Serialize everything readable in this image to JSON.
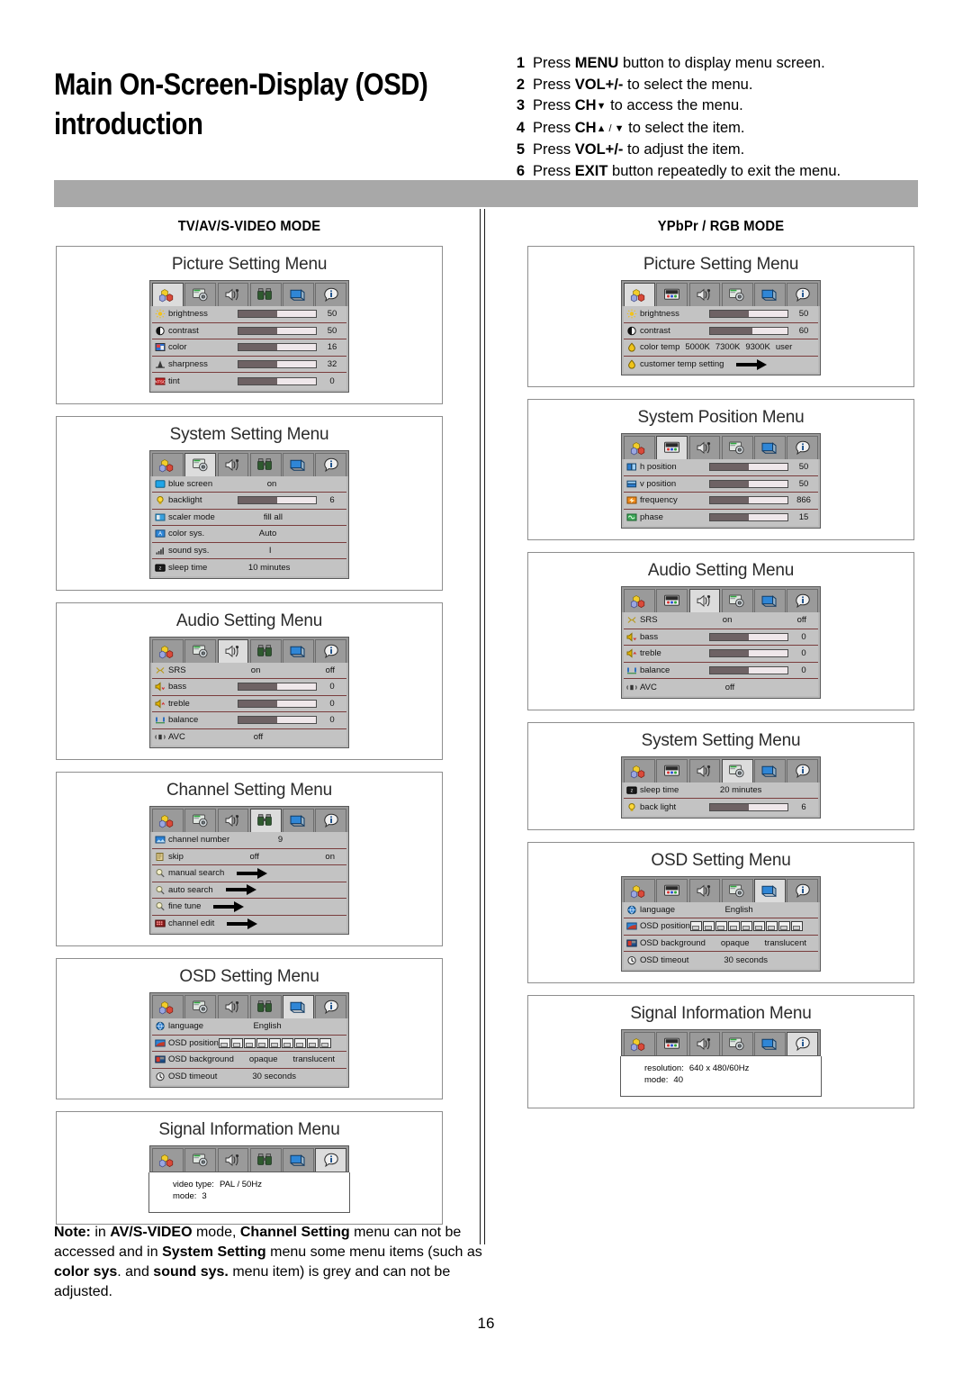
{
  "header": {
    "title": "Main On-Screen-Display (OSD) introduction",
    "steps": [
      {
        "num": "1",
        "pre": "Press ",
        "strong": "MENU",
        "post": " button to display menu screen."
      },
      {
        "num": "2",
        "pre": "Press ",
        "strong": "VOL+/-",
        "post": " to select the menu."
      },
      {
        "num": "3",
        "pre": "Press ",
        "strong": "CH",
        "glyph": "▼",
        "post": " to access the menu."
      },
      {
        "num": "4",
        "pre": "Press ",
        "strong": "CH",
        "glyph": "▲ / ▼",
        "post": " to select the item."
      },
      {
        "num": "5",
        "pre": "Press ",
        "strong": "VOL+/-",
        "post": " to adjust the item."
      },
      {
        "num": "6",
        "pre": "Press ",
        "strong": "EXIT",
        "post": " button repeatedly to exit the menu."
      }
    ]
  },
  "columns": {
    "left": {
      "heading": "TV/AV/S-VIDEO MODE",
      "menus": [
        {
          "title": "Picture Setting Menu",
          "selected_tab": 0,
          "tab_set": "tv",
          "rows": [
            {
              "icon": "brightness-icon",
              "label": "brightness",
              "type": "slider",
              "fill": 50,
              "value": "50"
            },
            {
              "icon": "contrast-icon",
              "label": "contrast",
              "type": "slider",
              "fill": 50,
              "value": "50"
            },
            {
              "icon": "color-icon",
              "label": "color",
              "type": "slider",
              "fill": 50,
              "value": "16"
            },
            {
              "icon": "sharpness-icon",
              "label": "sharpness",
              "type": "slider",
              "fill": 50,
              "value": "32"
            },
            {
              "icon": "tint-icon",
              "label": "tint",
              "type": "slider",
              "fill": 50,
              "value": "0"
            }
          ]
        },
        {
          "title": "System Setting Menu",
          "selected_tab": 1,
          "tab_set": "tv",
          "rows": [
            {
              "icon": "blue-screen-icon",
              "label": "blue screen",
              "type": "value",
              "value": "on"
            },
            {
              "icon": "backlight-icon",
              "label": "backlight",
              "type": "slider",
              "fill": 50,
              "value": "6"
            },
            {
              "icon": "scaler-icon",
              "label": "scaler mode",
              "type": "value",
              "value": "fill all"
            },
            {
              "icon": "color-sys-icon",
              "label": "color sys.",
              "type": "value",
              "value": "Auto"
            },
            {
              "icon": "sound-sys-icon",
              "label": "sound sys.",
              "type": "value",
              "value": "I"
            },
            {
              "icon": "sleep-time-icon",
              "label": "sleep time",
              "type": "value",
              "value": "10 minutes"
            }
          ]
        },
        {
          "title": "Audio Setting Menu",
          "selected_tab": 2,
          "tab_set": "tv",
          "rows": [
            {
              "icon": "srs-icon",
              "label": "SRS",
              "type": "dual",
              "value": "on",
              "value2": "off"
            },
            {
              "icon": "bass-icon",
              "label": "bass",
              "type": "slider",
              "fill": 50,
              "value": "0"
            },
            {
              "icon": "treble-icon",
              "label": "treble",
              "type": "slider",
              "fill": 50,
              "value": "0"
            },
            {
              "icon": "balance-icon",
              "label": "balance",
              "type": "slider",
              "fill": 50,
              "value": "0"
            },
            {
              "icon": "avc-icon",
              "label": "AVC",
              "type": "value",
              "value": "off"
            }
          ]
        },
        {
          "title": "Channel Setting Menu",
          "selected_tab": 3,
          "tab_set": "tv",
          "rows": [
            {
              "icon": "channel-number-icon",
              "label": "channel number",
              "type": "value",
              "value": "9"
            },
            {
              "icon": "skip-icon",
              "label": "skip",
              "type": "dual",
              "value": "off",
              "value2": "on"
            },
            {
              "icon": "search-icon",
              "label": "manual search",
              "type": "arrow"
            },
            {
              "icon": "search-icon",
              "label": "auto search",
              "type": "arrow"
            },
            {
              "icon": "search-icon",
              "label": "fine tune",
              "type": "arrow"
            },
            {
              "icon": "channel-edit-icon",
              "label": "channel edit",
              "type": "arrow"
            }
          ]
        },
        {
          "title": "OSD Setting Menu",
          "selected_tab": 4,
          "tab_set": "tv",
          "rows": [
            {
              "icon": "language-icon",
              "label": "language",
              "type": "value",
              "value": "English"
            },
            {
              "icon": "osd-position-icon",
              "label": "OSD position",
              "type": "posboxes",
              "boxes": 9
            },
            {
              "icon": "osd-background-icon",
              "label": "OSD background",
              "type": "dual",
              "value": "opaque",
              "value2": "translucent"
            },
            {
              "icon": "osd-timeout-icon",
              "label": "OSD timeout",
              "type": "value",
              "value": "30 seconds"
            }
          ]
        },
        {
          "title": "Signal Information Menu",
          "selected_tab": 5,
          "tab_set": "tv",
          "info": [
            {
              "key": "video type:",
              "value": "PAL / 50Hz"
            },
            {
              "key": "mode:",
              "value": "3"
            }
          ]
        }
      ]
    },
    "right": {
      "heading": "YPbPr / RGB MODE",
      "menus": [
        {
          "title": "Picture Setting Menu",
          "selected_tab": 0,
          "tab_set": "pc",
          "rows": [
            {
              "icon": "brightness-icon",
              "label": "brightness",
              "type": "slider",
              "fill": 50,
              "value": "50"
            },
            {
              "icon": "contrast-icon",
              "label": "contrast",
              "type": "slider",
              "fill": 55,
              "value": "60"
            },
            {
              "icon": "color-temp-icon",
              "label": "color temp",
              "type": "options",
              "options": [
                "5000K",
                "7300K",
                "9300K",
                "user"
              ]
            },
            {
              "icon": "color-temp-icon",
              "label": "customer temp setting",
              "type": "arrow"
            }
          ]
        },
        {
          "title": "System Position Menu",
          "selected_tab": 1,
          "tab_set": "pc",
          "rows": [
            {
              "icon": "h-position-icon",
              "label": "h position",
              "type": "slider",
              "fill": 50,
              "value": "50"
            },
            {
              "icon": "v-position-icon",
              "label": "v position",
              "type": "slider",
              "fill": 50,
              "value": "50"
            },
            {
              "icon": "frequency-icon",
              "label": "frequency",
              "type": "slider",
              "fill": 50,
              "value": "866"
            },
            {
              "icon": "phase-icon",
              "label": "phase",
              "type": "slider",
              "fill": 50,
              "value": "15"
            }
          ]
        },
        {
          "title": "Audio Setting Menu",
          "selected_tab": 2,
          "tab_set": "pc",
          "rows": [
            {
              "icon": "srs-icon",
              "label": "SRS",
              "type": "dual",
              "value": "on",
              "value2": "off"
            },
            {
              "icon": "bass-icon",
              "label": "bass",
              "type": "slider",
              "fill": 50,
              "value": "0"
            },
            {
              "icon": "treble-icon",
              "label": "treble",
              "type": "slider",
              "fill": 50,
              "value": "0"
            },
            {
              "icon": "balance-icon",
              "label": "balance",
              "type": "slider",
              "fill": 50,
              "value": "0"
            },
            {
              "icon": "avc-icon",
              "label": "AVC",
              "type": "value",
              "value": "off"
            }
          ]
        },
        {
          "title": "System Setting Menu",
          "selected_tab": 3,
          "tab_set": "pc",
          "rows": [
            {
              "icon": "sleep-time-icon",
              "label": "sleep time",
              "type": "value",
              "value": "20   minutes"
            },
            {
              "icon": "backlight-icon",
              "label": "back light",
              "type": "slider",
              "fill": 50,
              "value": "6"
            }
          ]
        },
        {
          "title": "OSD Setting Menu",
          "selected_tab": 4,
          "tab_set": "pc",
          "rows": [
            {
              "icon": "language-icon",
              "label": "language",
              "type": "value",
              "value": "English"
            },
            {
              "icon": "osd-position-icon",
              "label": "OSD position",
              "type": "posboxes",
              "boxes": 9
            },
            {
              "icon": "osd-background-icon",
              "label": "OSD background",
              "type": "dual",
              "value": "opaque",
              "value2": "translucent"
            },
            {
              "icon": "osd-timeout-icon",
              "label": "OSD timeout",
              "type": "value",
              "value": "30 seconds"
            }
          ]
        },
        {
          "title": "Signal Information Menu",
          "selected_tab": 5,
          "tab_set": "pc",
          "info": [
            {
              "key": "resolution:",
              "value": "640 x 480/60Hz"
            },
            {
              "key": "mode:",
              "value": "40"
            }
          ]
        }
      ]
    }
  },
  "note": {
    "parts": [
      {
        "t": "Note:",
        "b": true
      },
      {
        "t": " in ",
        "b": false
      },
      {
        "t": "AV/S-VIDEO",
        "b": true
      },
      {
        "t": " mode, ",
        "b": false
      },
      {
        "t": "Channel Setting",
        "b": true
      },
      {
        "t": " menu can not be accessed and in ",
        "b": false
      },
      {
        "t": "System Setting",
        "b": true
      },
      {
        "t": " menu some menu items (such as ",
        "b": false
      },
      {
        "t": "color sys",
        "b": true
      },
      {
        "t": ". and ",
        "b": false
      },
      {
        "t": "sound sys.",
        "b": true
      },
      {
        "t": " menu item) is grey and can not be adjusted.",
        "b": false
      }
    ]
  },
  "page_number": "16",
  "colors": {
    "gray_bar": "#a8a8a8",
    "osd_row": "#c3c3c3",
    "osd_frame": "#b9b9b9",
    "tab_selected": "#dcdcdc",
    "slider_fill": "#6e6264"
  }
}
